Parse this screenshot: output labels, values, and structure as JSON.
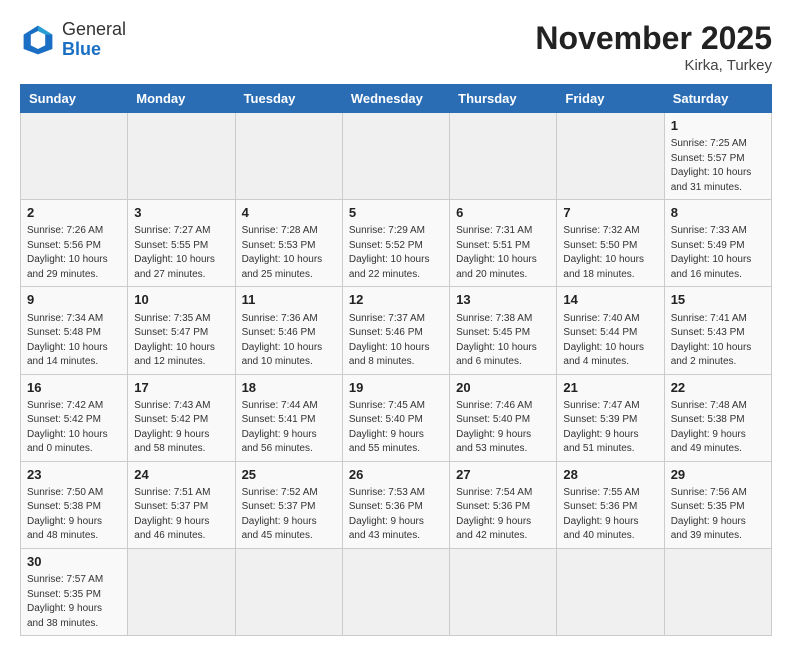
{
  "header": {
    "logo_general": "General",
    "logo_blue": "Blue",
    "month_title": "November 2025",
    "location": "Kirka, Turkey"
  },
  "days_of_week": [
    "Sunday",
    "Monday",
    "Tuesday",
    "Wednesday",
    "Thursday",
    "Friday",
    "Saturday"
  ],
  "weeks": [
    [
      {
        "day": "",
        "info": ""
      },
      {
        "day": "",
        "info": ""
      },
      {
        "day": "",
        "info": ""
      },
      {
        "day": "",
        "info": ""
      },
      {
        "day": "",
        "info": ""
      },
      {
        "day": "",
        "info": ""
      },
      {
        "day": "1",
        "info": "Sunrise: 7:25 AM\nSunset: 5:57 PM\nDaylight: 10 hours\nand 31 minutes."
      }
    ],
    [
      {
        "day": "2",
        "info": "Sunrise: 7:26 AM\nSunset: 5:56 PM\nDaylight: 10 hours\nand 29 minutes."
      },
      {
        "day": "3",
        "info": "Sunrise: 7:27 AM\nSunset: 5:55 PM\nDaylight: 10 hours\nand 27 minutes."
      },
      {
        "day": "4",
        "info": "Sunrise: 7:28 AM\nSunset: 5:53 PM\nDaylight: 10 hours\nand 25 minutes."
      },
      {
        "day": "5",
        "info": "Sunrise: 7:29 AM\nSunset: 5:52 PM\nDaylight: 10 hours\nand 22 minutes."
      },
      {
        "day": "6",
        "info": "Sunrise: 7:31 AM\nSunset: 5:51 PM\nDaylight: 10 hours\nand 20 minutes."
      },
      {
        "day": "7",
        "info": "Sunrise: 7:32 AM\nSunset: 5:50 PM\nDaylight: 10 hours\nand 18 minutes."
      },
      {
        "day": "8",
        "info": "Sunrise: 7:33 AM\nSunset: 5:49 PM\nDaylight: 10 hours\nand 16 minutes."
      }
    ],
    [
      {
        "day": "9",
        "info": "Sunrise: 7:34 AM\nSunset: 5:48 PM\nDaylight: 10 hours\nand 14 minutes."
      },
      {
        "day": "10",
        "info": "Sunrise: 7:35 AM\nSunset: 5:47 PM\nDaylight: 10 hours\nand 12 minutes."
      },
      {
        "day": "11",
        "info": "Sunrise: 7:36 AM\nSunset: 5:46 PM\nDaylight: 10 hours\nand 10 minutes."
      },
      {
        "day": "12",
        "info": "Sunrise: 7:37 AM\nSunset: 5:46 PM\nDaylight: 10 hours\nand 8 minutes."
      },
      {
        "day": "13",
        "info": "Sunrise: 7:38 AM\nSunset: 5:45 PM\nDaylight: 10 hours\nand 6 minutes."
      },
      {
        "day": "14",
        "info": "Sunrise: 7:40 AM\nSunset: 5:44 PM\nDaylight: 10 hours\nand 4 minutes."
      },
      {
        "day": "15",
        "info": "Sunrise: 7:41 AM\nSunset: 5:43 PM\nDaylight: 10 hours\nand 2 minutes."
      }
    ],
    [
      {
        "day": "16",
        "info": "Sunrise: 7:42 AM\nSunset: 5:42 PM\nDaylight: 10 hours\nand 0 minutes."
      },
      {
        "day": "17",
        "info": "Sunrise: 7:43 AM\nSunset: 5:42 PM\nDaylight: 9 hours\nand 58 minutes."
      },
      {
        "day": "18",
        "info": "Sunrise: 7:44 AM\nSunset: 5:41 PM\nDaylight: 9 hours\nand 56 minutes."
      },
      {
        "day": "19",
        "info": "Sunrise: 7:45 AM\nSunset: 5:40 PM\nDaylight: 9 hours\nand 55 minutes."
      },
      {
        "day": "20",
        "info": "Sunrise: 7:46 AM\nSunset: 5:40 PM\nDaylight: 9 hours\nand 53 minutes."
      },
      {
        "day": "21",
        "info": "Sunrise: 7:47 AM\nSunset: 5:39 PM\nDaylight: 9 hours\nand 51 minutes."
      },
      {
        "day": "22",
        "info": "Sunrise: 7:48 AM\nSunset: 5:38 PM\nDaylight: 9 hours\nand 49 minutes."
      }
    ],
    [
      {
        "day": "23",
        "info": "Sunrise: 7:50 AM\nSunset: 5:38 PM\nDaylight: 9 hours\nand 48 minutes."
      },
      {
        "day": "24",
        "info": "Sunrise: 7:51 AM\nSunset: 5:37 PM\nDaylight: 9 hours\nand 46 minutes."
      },
      {
        "day": "25",
        "info": "Sunrise: 7:52 AM\nSunset: 5:37 PM\nDaylight: 9 hours\nand 45 minutes."
      },
      {
        "day": "26",
        "info": "Sunrise: 7:53 AM\nSunset: 5:36 PM\nDaylight: 9 hours\nand 43 minutes."
      },
      {
        "day": "27",
        "info": "Sunrise: 7:54 AM\nSunset: 5:36 PM\nDaylight: 9 hours\nand 42 minutes."
      },
      {
        "day": "28",
        "info": "Sunrise: 7:55 AM\nSunset: 5:36 PM\nDaylight: 9 hours\nand 40 minutes."
      },
      {
        "day": "29",
        "info": "Sunrise: 7:56 AM\nSunset: 5:35 PM\nDaylight: 9 hours\nand 39 minutes."
      }
    ],
    [
      {
        "day": "30",
        "info": "Sunrise: 7:57 AM\nSunset: 5:35 PM\nDaylight: 9 hours\nand 38 minutes."
      },
      {
        "day": "",
        "info": ""
      },
      {
        "day": "",
        "info": ""
      },
      {
        "day": "",
        "info": ""
      },
      {
        "day": "",
        "info": ""
      },
      {
        "day": "",
        "info": ""
      },
      {
        "day": "",
        "info": ""
      }
    ]
  ]
}
